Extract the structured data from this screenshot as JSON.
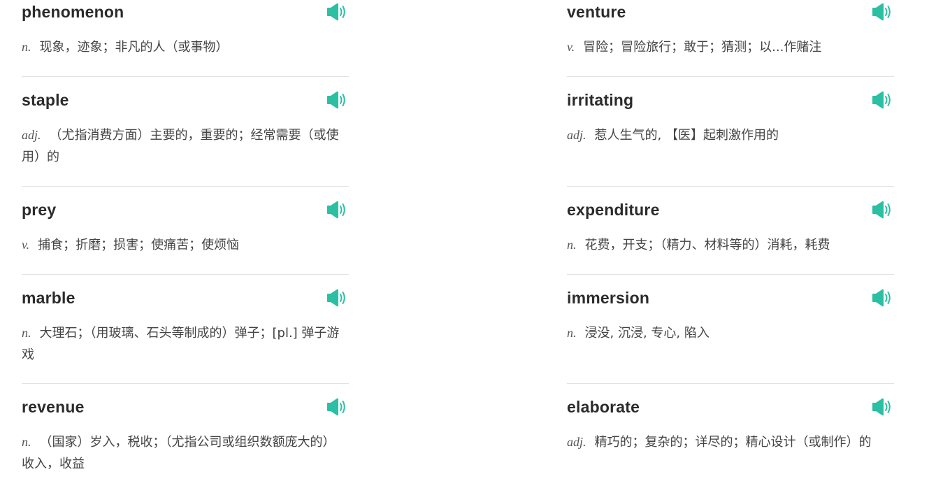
{
  "left_column": [
    {
      "word": "phenomenon",
      "pos": "n.",
      "definition": "现象，迹象；非凡的人（或事物）"
    },
    {
      "word": "staple",
      "pos": "adj.",
      "definition": "（尤指消费方面）主要的，重要的；经常需要（或使用）的"
    },
    {
      "word": "prey",
      "pos": "v.",
      "definition": "捕食；折磨；损害；使痛苦；使烦恼"
    },
    {
      "word": "marble",
      "pos": "n.",
      "definition": "大理石；（用玻璃、石头等制成的）弹子；[pl.] 弹子游戏"
    },
    {
      "word": "revenue",
      "pos": "n.",
      "definition": "（国家）岁入，税收；（尤指公司或组织数额庞大的）收入，收益"
    }
  ],
  "right_column": [
    {
      "word": "venture",
      "pos": "v.",
      "definition": "冒险；冒险旅行；敢于；猜测；以...作赌注"
    },
    {
      "word": "irritating",
      "pos": "adj.",
      "definition": "惹人生气的, 【医】起刺激作用的"
    },
    {
      "word": "expenditure",
      "pos": "n.",
      "definition": "花费，开支；（精力、材料等的）消耗，耗费"
    },
    {
      "word": "immersion",
      "pos": "n.",
      "definition": "浸没, 沉浸, 专心, 陷入"
    },
    {
      "word": "elaborate",
      "pos": "adj.",
      "definition": "精巧的；复杂的；详尽的；精心设计（或制作）的"
    }
  ],
  "icons": {
    "audio": "speaker-icon"
  },
  "colors": {
    "accent": "#2bbfa4",
    "word": "#2b2b2b",
    "definition": "#444444",
    "divider": "#e2e2e2"
  }
}
